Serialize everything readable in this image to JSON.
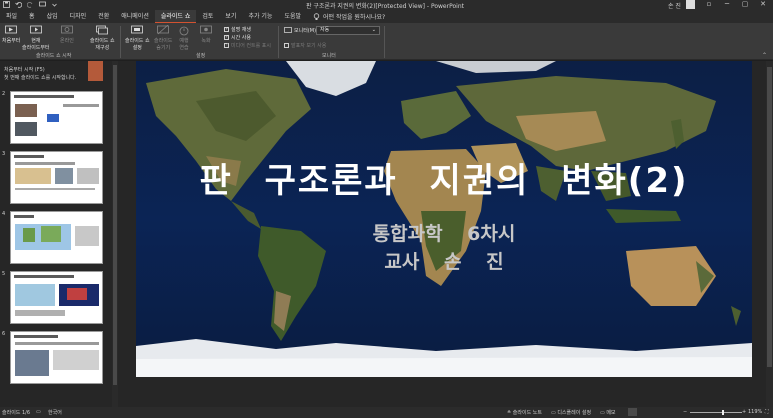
{
  "window": {
    "title": "판 구조론과 지권의 변화(2)[Protected View]  -  PowerPoint",
    "user": "손 진",
    "controls": [
      "─",
      "▢",
      "✕"
    ]
  },
  "tabs": [
    "파일",
    "홈",
    "삽입",
    "디자인",
    "전환",
    "애니메이션",
    "슬라이드 쇼",
    "검토",
    "보기",
    "추가 기능",
    "도움말"
  ],
  "active_tab": "슬라이드 쇼",
  "tell_me": "어떤 작업을 원하시나요?",
  "ribbon": {
    "start": {
      "from_beginning": "처음부터",
      "from_current_line1": "현재",
      "from_current_line2": "슬라이드부터",
      "online": "온라인",
      "custom": "슬라이드 쇼",
      "custom_line2": "재구성",
      "group_label": "슬라이드 쇼 시작"
    },
    "setup": {
      "setup_show_line1": "슬라이드 쇼",
      "setup_show_line2": "설정",
      "hide_slide_line1": "슬라이드",
      "hide_slide_line2": "숨기기",
      "rehearse_line1": "예행",
      "rehearse_line2": "연습",
      "record": "녹화",
      "play_narration": "설명 재생",
      "use_timings": "시간 사용",
      "show_media_controls": "미디어 컨트롤 표시",
      "group_label": "설정"
    },
    "monitors": {
      "monitor_label": "모니터(M):",
      "monitor_value": "자동",
      "presenter_view": "발표자 보기 사용",
      "group_label": "모니터"
    }
  },
  "left_pane": {
    "hint_line1": "처음부터 시작 (F5)",
    "hint_line2": "첫 번째 슬라이드 쇼를 시작합니다.",
    "thumbnails": [
      "2",
      "3",
      "4",
      "5",
      "6"
    ]
  },
  "slide": {
    "title": "판 구조론과 지권의 변화(2)",
    "subtitle": "통합과학 6차시",
    "teacher": "교사 손 진"
  },
  "statusbar": {
    "slide_count": "슬라이드 1/6",
    "language": "한국어",
    "notes": "슬라이드 노트",
    "display_settings": "디스플레이 설정",
    "comments": "메모",
    "zoom": "119%"
  },
  "colors": {
    "accent": "#d35230",
    "background": "#262626",
    "ribbon": "#3a3a3a",
    "titlebar": "#2b2b2b"
  }
}
